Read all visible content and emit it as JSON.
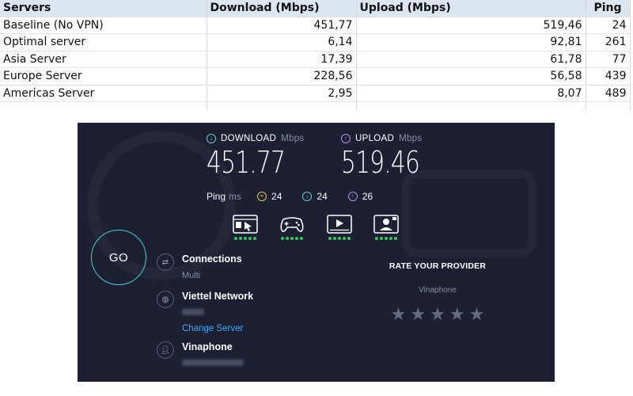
{
  "sheet": {
    "headers": [
      "Servers",
      "Download (Mbps)",
      "Upload (Mbps)",
      "Ping"
    ],
    "rows": [
      {
        "server": "Baseline (No VPN)",
        "download": "451,77",
        "upload": "519,46",
        "ping": "24"
      },
      {
        "server": "Optimal server",
        "download": "6,14",
        "upload": "92,81",
        "ping": "261"
      },
      {
        "server": "Asia Server",
        "download": "17,39",
        "upload": "61,78",
        "ping": "77"
      },
      {
        "server": "Europe Server",
        "download": "228,56",
        "upload": "56,58",
        "ping": "439"
      },
      {
        "server": "Americas Server",
        "download": "2,95",
        "upload": "8,07",
        "ping": "489"
      }
    ]
  },
  "speedtest": {
    "download": {
      "label": "DOWNLOAD",
      "unit": "Mbps",
      "value": "451.77"
    },
    "upload": {
      "label": "UPLOAD",
      "unit": "Mbps",
      "value": "519.46"
    },
    "ping": {
      "label": "Ping",
      "unit": "ms",
      "jitter": "24",
      "download": "24",
      "upload": "26"
    },
    "activities": [
      {
        "icon": "browsing-icon",
        "rating": 5
      },
      {
        "icon": "gaming-icon",
        "rating": 5
      },
      {
        "icon": "streaming-icon",
        "rating": 5
      },
      {
        "icon": "video-call-icon",
        "rating": 5
      }
    ],
    "go_label": "GO",
    "connections": {
      "label": "Connections",
      "value": "Multi"
    },
    "server": {
      "name": "Viettel Network",
      "change_label": "Change Server"
    },
    "provider": {
      "name": "Vinaphone"
    },
    "rate": {
      "title": "RATE YOUR PROVIDER",
      "provider": "Vinaphone",
      "stars": 5
    },
    "colors": {
      "background": "#1d2033",
      "download": "#5ed3d0",
      "upload": "#b78cf3",
      "jitter": "#e9c65b",
      "go_ring": "#4dc9d6",
      "link": "#3fa9f5",
      "rating_dots": "#34c759"
    }
  }
}
